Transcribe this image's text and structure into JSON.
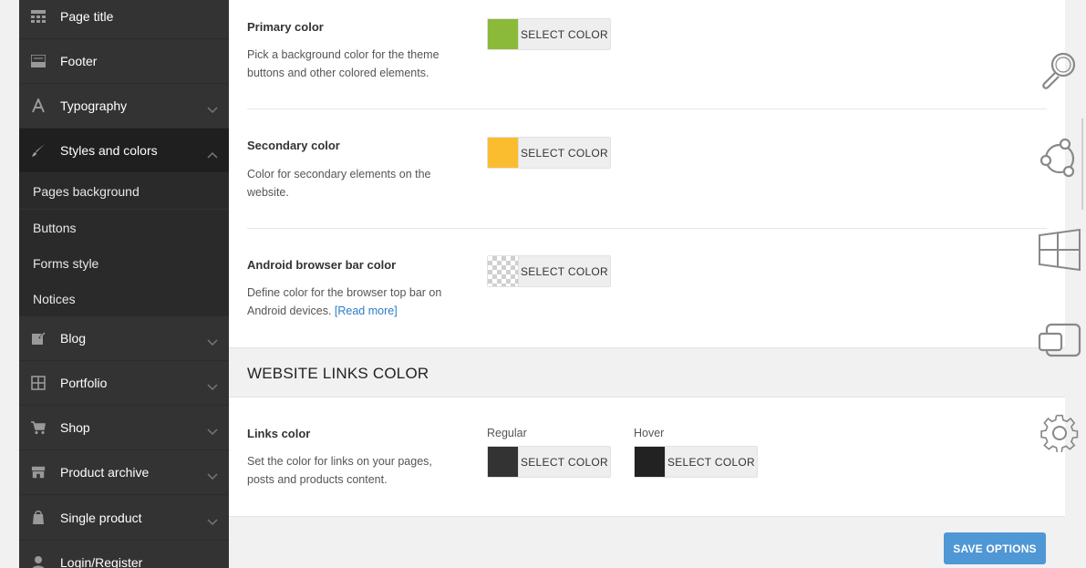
{
  "sidebar": {
    "items": [
      {
        "label": "Page title",
        "icon": "page-title-icon"
      },
      {
        "label": "Footer",
        "icon": "footer-icon"
      },
      {
        "label": "Typography",
        "icon": "typography-icon"
      },
      {
        "label": "Styles and colors",
        "icon": "brush-icon"
      },
      {
        "label": "Blog",
        "icon": "blog-icon"
      },
      {
        "label": "Portfolio",
        "icon": "portfolio-icon"
      },
      {
        "label": "Shop",
        "icon": "cart-icon"
      },
      {
        "label": "Product archive",
        "icon": "store-icon"
      },
      {
        "label": "Single product",
        "icon": "bag-icon"
      },
      {
        "label": "Login/Register",
        "icon": "user-icon"
      }
    ],
    "subitems": [
      {
        "label": "Pages background"
      },
      {
        "label": "Buttons"
      },
      {
        "label": "Forms style"
      },
      {
        "label": "Notices"
      }
    ]
  },
  "main": {
    "primary": {
      "title": "Primary color",
      "desc": "Pick a background color for the theme buttons and other colored elements.",
      "button": "SELECT COLOR",
      "color": "#8bb93a"
    },
    "secondary": {
      "title": "Secondary color",
      "desc": "Color for secondary elements on the website.",
      "button": "SELECT COLOR",
      "color": "#fbbd30"
    },
    "android": {
      "title": "Android browser bar color",
      "desc": "Define color for the browser top bar on Android devices.",
      "link": "[Read more]",
      "button": "SELECT COLOR"
    },
    "section_title": "WEBSITE LINKS COLOR",
    "links": {
      "title": "Links color",
      "desc": "Set the color for links on your pages, posts and products content.",
      "regular_label": "Regular",
      "hover_label": "Hover",
      "regular_button": "SELECT COLOR",
      "hover_button": "SELECT COLOR",
      "regular_color": "#333333",
      "hover_color": "#222222"
    },
    "save_label": "SAVE OPTIONS"
  },
  "toolbar": {
    "icons": [
      "search-icon",
      "share-icon",
      "windows-icon",
      "devices-icon",
      "gear-icon"
    ]
  }
}
